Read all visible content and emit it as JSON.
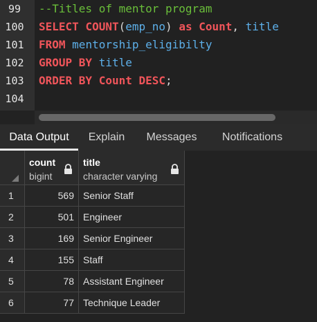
{
  "editor": {
    "lines": [
      {
        "num": "99",
        "tokens": [
          {
            "t": "--Titles of mentor program",
            "k": "comment"
          }
        ]
      },
      {
        "num": "100",
        "tokens": [
          {
            "t": "SELECT ",
            "k": "keyword"
          },
          {
            "t": "COUNT",
            "k": "keyword"
          },
          {
            "t": "(",
            "k": "punct"
          },
          {
            "t": "emp_no",
            "k": "ident"
          },
          {
            "t": ") ",
            "k": "punct"
          },
          {
            "t": "as ",
            "k": "keyword"
          },
          {
            "t": "Count",
            "k": "keyword"
          },
          {
            "t": ", ",
            "k": "punct"
          },
          {
            "t": "title",
            "k": "ident"
          }
        ]
      },
      {
        "num": "101",
        "tokens": [
          {
            "t": "FROM ",
            "k": "keyword"
          },
          {
            "t": "mentorship_eligibilty",
            "k": "ident"
          }
        ]
      },
      {
        "num": "102",
        "tokens": [
          {
            "t": "GROUP BY ",
            "k": "keyword"
          },
          {
            "t": "title",
            "k": "ident"
          }
        ]
      },
      {
        "num": "103",
        "tokens": [
          {
            "t": "ORDER BY ",
            "k": "keyword"
          },
          {
            "t": "Count ",
            "k": "keyword"
          },
          {
            "t": "DESC",
            "k": "keyword"
          },
          {
            "t": ";",
            "k": "punct"
          }
        ]
      },
      {
        "num": "104",
        "tokens": []
      }
    ]
  },
  "tabs": {
    "data_output": "Data Output",
    "explain": "Explain",
    "messages": "Messages",
    "notifications": "Notifications"
  },
  "grid": {
    "columns": [
      {
        "name": "count",
        "type": "bigint"
      },
      {
        "name": "title",
        "type": "character varying"
      }
    ],
    "rows": [
      {
        "row": "1",
        "count": "569",
        "title": "Senior Staff"
      },
      {
        "row": "2",
        "count": "501",
        "title": "Engineer"
      },
      {
        "row": "3",
        "count": "169",
        "title": "Senior Engineer"
      },
      {
        "row": "4",
        "count": "155",
        "title": "Staff"
      },
      {
        "row": "5",
        "count": "78",
        "title": "Assistant Engineer"
      },
      {
        "row": "6",
        "count": "77",
        "title": "Technique Leader"
      }
    ]
  },
  "colors": {
    "keyword": "#f0555a",
    "identifier": "#5db0ea",
    "comment": "#6abf3a",
    "background": "#212121"
  },
  "icons": {
    "column_lock": "lock-icon",
    "row_header_corner": "corner-triangle-icon"
  }
}
